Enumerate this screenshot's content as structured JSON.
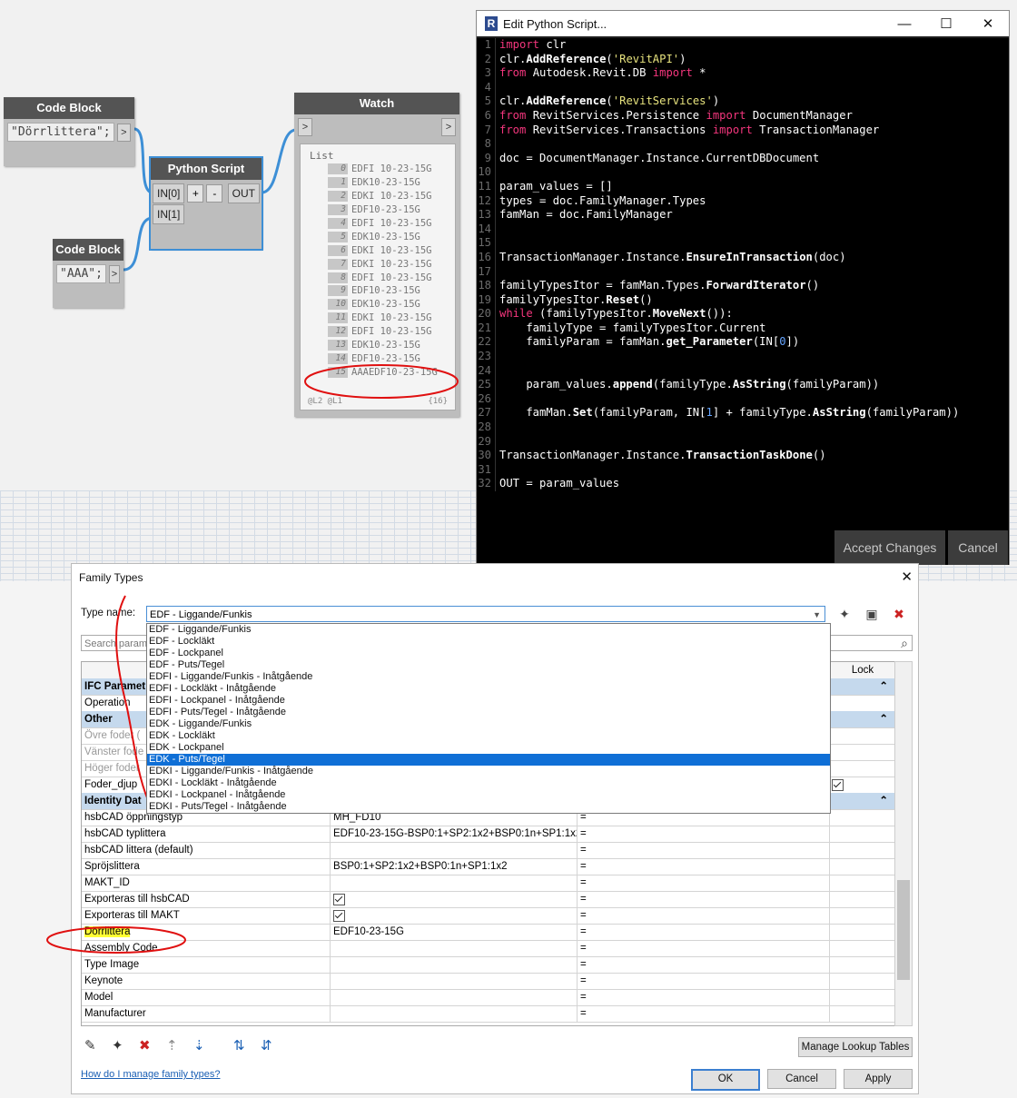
{
  "dynamo": {
    "code_block_1": {
      "title": "Code Block",
      "code": "\"Dörrlittera\";",
      "out": ">"
    },
    "code_block_2": {
      "title": "Code Block",
      "code": "\"AAA\";",
      "out": ">"
    },
    "python_node": {
      "title": "Python Script",
      "in0": "IN[0]",
      "in1": "IN[1]",
      "plus": "+",
      "minus": "-",
      "out": "OUT"
    },
    "watch": {
      "title": "Watch",
      "in_port": ">",
      "out_port": ">",
      "list_label": "List",
      "items": [
        {
          "i": "0",
          "v": "EDFI 10-23-15G"
        },
        {
          "i": "1",
          "v": "EDK10-23-15G"
        },
        {
          "i": "2",
          "v": "EDKI 10-23-15G"
        },
        {
          "i": "3",
          "v": "EDF10-23-15G"
        },
        {
          "i": "4",
          "v": "EDFI 10-23-15G"
        },
        {
          "i": "5",
          "v": "EDK10-23-15G"
        },
        {
          "i": "6",
          "v": "EDKI 10-23-15G"
        },
        {
          "i": "7",
          "v": "EDKI 10-23-15G"
        },
        {
          "i": "8",
          "v": "EDFI 10-23-15G"
        },
        {
          "i": "9",
          "v": "EDF10-23-15G"
        },
        {
          "i": "10",
          "v": "EDK10-23-15G"
        },
        {
          "i": "11",
          "v": "EDKI 10-23-15G"
        },
        {
          "i": "12",
          "v": "EDFI 10-23-15G"
        },
        {
          "i": "13",
          "v": "EDK10-23-15G"
        },
        {
          "i": "14",
          "v": "EDF10-23-15G"
        },
        {
          "i": "15",
          "v": "AAAEDF10-23-15G"
        }
      ],
      "levels": "@L2 @L1",
      "count": "{16}"
    }
  },
  "editor": {
    "title": "Edit Python Script...",
    "logo": "R",
    "minimize": "—",
    "maximize": "☐",
    "close": "✕",
    "accept": "Accept Changes",
    "cancel": "Cancel"
  },
  "code_lines": [
    [
      [
        "kw",
        "import"
      ],
      [
        "t",
        " clr"
      ]
    ],
    [
      [
        "t",
        "clr."
      ],
      [
        "fn",
        "AddReference"
      ],
      [
        "t",
        "("
      ],
      [
        "str",
        "'RevitAPI'"
      ],
      [
        "t",
        ")"
      ]
    ],
    [
      [
        "kw",
        "from"
      ],
      [
        "t",
        " Autodesk.Revit.DB "
      ],
      [
        "kw",
        "import"
      ],
      [
        "t",
        " *"
      ]
    ],
    [],
    [
      [
        "t",
        "clr."
      ],
      [
        "fn",
        "AddReference"
      ],
      [
        "t",
        "("
      ],
      [
        "str",
        "'RevitServices'"
      ],
      [
        "t",
        ")"
      ]
    ],
    [
      [
        "kw",
        "from"
      ],
      [
        "t",
        " RevitServices.Persistence "
      ],
      [
        "kw",
        "import"
      ],
      [
        "t",
        " DocumentManager"
      ]
    ],
    [
      [
        "kw",
        "from"
      ],
      [
        "t",
        " RevitServices.Transactions "
      ],
      [
        "kw",
        "import"
      ],
      [
        "t",
        " TransactionManager"
      ]
    ],
    [],
    [
      [
        "t",
        "doc = DocumentManager.Instance.CurrentDBDocument"
      ]
    ],
    [],
    [
      [
        "t",
        "param_values = []"
      ]
    ],
    [
      [
        "t",
        "types = doc.FamilyManager.Types"
      ]
    ],
    [
      [
        "t",
        "famMan = doc.FamilyManager"
      ]
    ],
    [],
    [],
    [
      [
        "t",
        "TransactionManager.Instance."
      ],
      [
        "fn",
        "EnsureInTransaction"
      ],
      [
        "t",
        "(doc)"
      ]
    ],
    [],
    [
      [
        "t",
        "familyTypesItor = famMan.Types."
      ],
      [
        "fn",
        "ForwardIterator"
      ],
      [
        "t",
        "()"
      ]
    ],
    [
      [
        "t",
        "familyTypesItor."
      ],
      [
        "fn",
        "Reset"
      ],
      [
        "t",
        "()"
      ]
    ],
    [
      [
        "kw",
        "while"
      ],
      [
        "t",
        " (familyTypesItor."
      ],
      [
        "fn",
        "MoveNext"
      ],
      [
        "t",
        "()):"
      ]
    ],
    [
      [
        "t",
        "    familyType = familyTypesItor.Current"
      ]
    ],
    [
      [
        "t",
        "    familyParam = famMan."
      ],
      [
        "fn",
        "get_Parameter"
      ],
      [
        "t",
        "(IN["
      ],
      [
        "num",
        "0"
      ],
      [
        "t",
        "])"
      ]
    ],
    [],
    [],
    [
      [
        "t",
        "    param_values."
      ],
      [
        "fn",
        "append"
      ],
      [
        "t",
        "(familyType."
      ],
      [
        "fn",
        "AsString"
      ],
      [
        "t",
        "(familyParam))"
      ]
    ],
    [],
    [
      [
        "t",
        "    famMan."
      ],
      [
        "fn",
        "Set"
      ],
      [
        "t",
        "(familyParam, IN["
      ],
      [
        "num",
        "1"
      ],
      [
        "t",
        "] + familyType."
      ],
      [
        "fn",
        "AsString"
      ],
      [
        "t",
        "(familyParam))"
      ]
    ],
    [],
    [],
    [
      [
        "t",
        "TransactionManager.Instance."
      ],
      [
        "fn",
        "TransactionTaskDone"
      ],
      [
        "t",
        "()"
      ]
    ],
    [],
    [
      [
        "t",
        "OUT = param_values"
      ]
    ]
  ],
  "dialog": {
    "title": "Family Types",
    "close": "✕",
    "type_name_label": "Type name:",
    "type_name_value": "EDF - Liggande/Funkis",
    "search_placeholder": "Search param",
    "lock_header": "Lock",
    "dropdown_items": [
      "EDF - Liggande/Funkis",
      "EDF - Lockläkt",
      "EDF - Lockpanel",
      "EDF - Puts/Tegel",
      "EDFI - Liggande/Funkis - Inåtgående",
      "EDFI - Lockläkt - Inåtgående",
      "EDFI - Lockpanel - Inåtgående",
      "EDFI - Puts/Tegel - Inåtgående",
      "EDK - Liggande/Funkis",
      "EDK - Lockläkt",
      "EDK - Lockpanel",
      "EDK - Puts/Tegel",
      "EDKI - Liggande/Funkis - Inåtgående",
      "EDKI - Lockläkt - Inåtgående",
      "EDKI - Lockpanel - Inåtgående",
      "EDKI - Puts/Tegel - Inåtgående"
    ],
    "dropdown_selected_index": 11,
    "group_ifc": "IFC Paramet",
    "row_operation": "Operation",
    "group_other": "Other",
    "row_ovre": "Övre foder (",
    "row_vanster": "Vänster fode",
    "row_hoger": "Höger foder",
    "row_foder_djup": "Foder_djup",
    "group_identity": "Identity Dat",
    "rows": [
      {
        "name": "hsbCAD öppningstyp",
        "value": "MH_FD10",
        "formula": "="
      },
      {
        "name": "hsbCAD typlittera",
        "value": "EDF10-23-15G-BSP0:1+SP2:1x2+BSP0:1n+SP1:1x2",
        "formula": "="
      },
      {
        "name": "hsbCAD littera (default)",
        "value": "",
        "formula": "="
      },
      {
        "name": "Spröjslittera",
        "value": "BSP0:1+SP2:1x2+BSP0:1n+SP1:1x2",
        "formula": "="
      },
      {
        "name": "MAKT_ID",
        "value": "",
        "formula": "="
      },
      {
        "name": "Exporteras till hsbCAD",
        "value": "",
        "formula": "="
      },
      {
        "name": "Exporteras till MAKT",
        "value": "",
        "formula": "="
      },
      {
        "name": "Dörrlittera",
        "value": "EDF10-23-15G",
        "formula": "="
      },
      {
        "name": "Assembly Code",
        "value": "",
        "formula": "="
      },
      {
        "name": "Type Image",
        "value": "",
        "formula": "="
      },
      {
        "name": "Keynote",
        "value": "",
        "formula": "="
      },
      {
        "name": "Model",
        "value": "",
        "formula": "="
      },
      {
        "name": "Manufacturer",
        "value": "",
        "formula": "="
      }
    ],
    "manage_lookup": "Manage Lookup Tables",
    "help_link": "How do I manage family types?",
    "ok": "OK",
    "cancel": "Cancel",
    "apply": "Apply"
  },
  "colors": {
    "keyword": "#f4367d",
    "string": "#e7e37e",
    "number": "#66a5ff",
    "selection": "#0f6fd6",
    "group_header": "#c5d9ed",
    "highlighter": "#ffff33",
    "annotation": "#e01010"
  }
}
